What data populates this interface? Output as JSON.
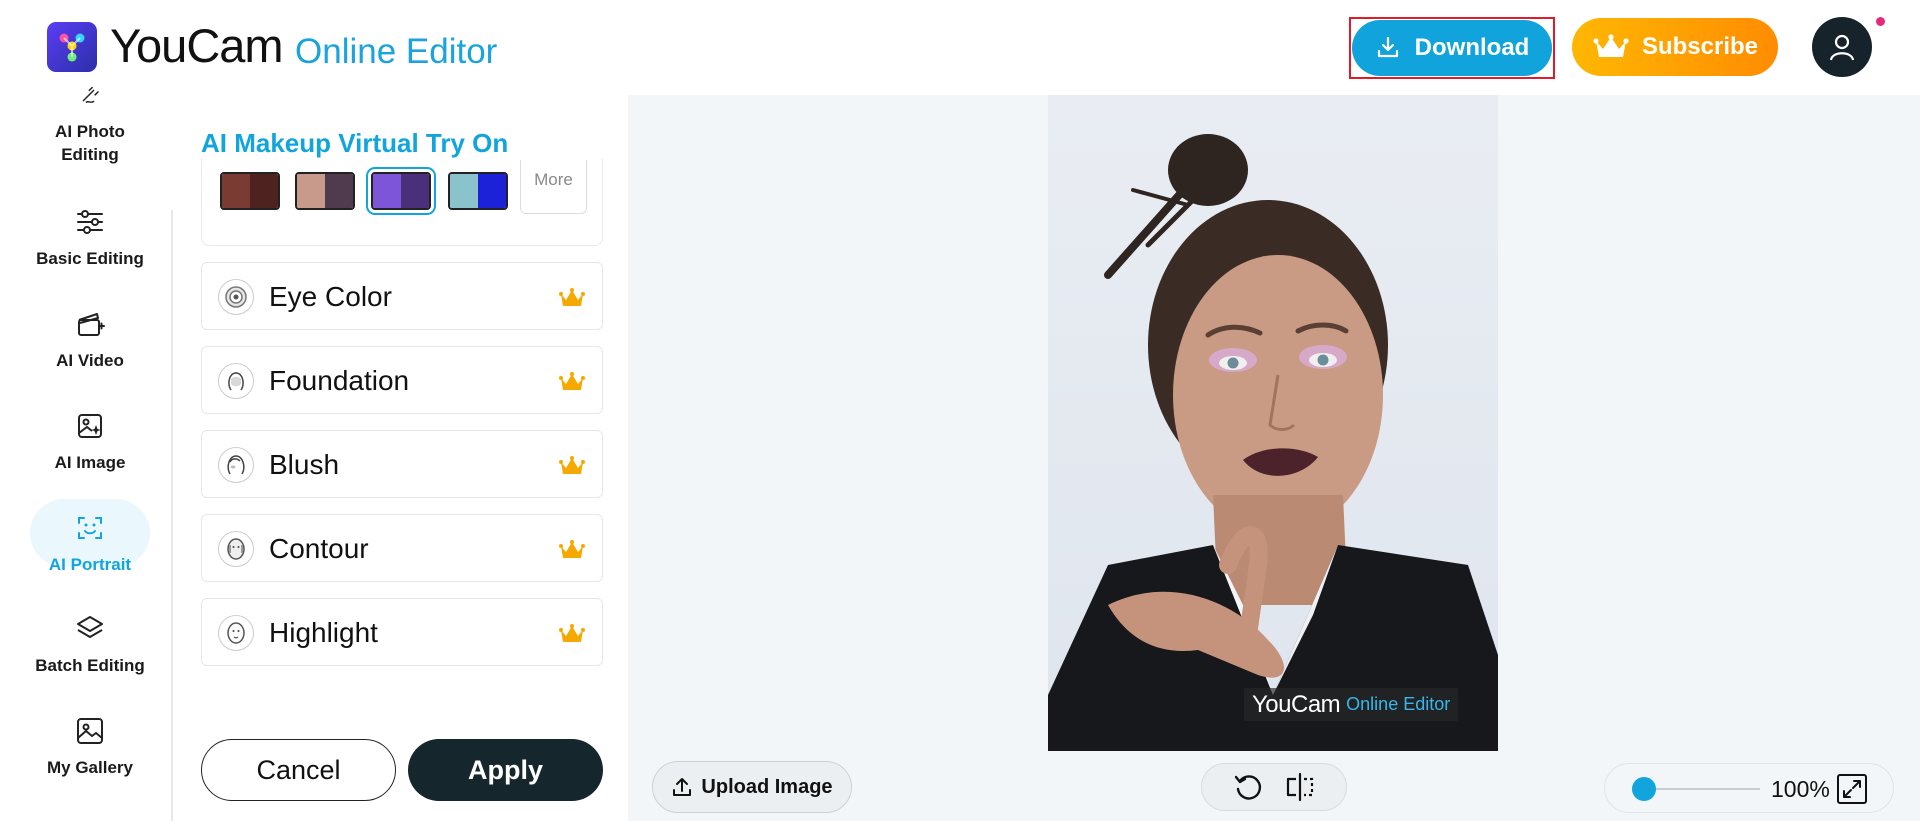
{
  "header": {
    "brand": "YouCam",
    "brand_sub": "Online Editor",
    "download_label": "Download",
    "subscribe_label": "Subscribe"
  },
  "nav": {
    "items": [
      {
        "label": "AI Photo Editing",
        "icon": "magic-wand-icon"
      },
      {
        "label": "Basic Editing",
        "icon": "sliders-icon"
      },
      {
        "label": "AI Video",
        "icon": "clapperboard-icon"
      },
      {
        "label": "AI Image",
        "icon": "image-sparkle-icon"
      },
      {
        "label": "AI Portrait",
        "icon": "face-scan-icon",
        "active": true
      },
      {
        "label": "Batch Editing",
        "icon": "layers-icon"
      },
      {
        "label": "My Gallery",
        "icon": "gallery-icon"
      }
    ]
  },
  "panel": {
    "title": "AI Makeup Virtual Try On",
    "more_label": "More",
    "features": [
      {
        "label": "Eye Color",
        "icon": "eye-color-icon"
      },
      {
        "label": "Foundation",
        "icon": "foundation-icon"
      },
      {
        "label": "Blush",
        "icon": "blush-icon"
      },
      {
        "label": "Contour",
        "icon": "contour-icon"
      },
      {
        "label": "Highlight",
        "icon": "highlight-icon"
      }
    ],
    "cancel_label": "Cancel",
    "apply_label": "Apply"
  },
  "canvas": {
    "watermark_brand": "YouCam",
    "watermark_sub": "Online Editor",
    "upload_label": "Upload Image",
    "zoom_value": "100%",
    "zoom_level": 0.1
  },
  "colors": {
    "accent": "#12a4dd",
    "subscribe_gradient_start": "#ffb703",
    "subscribe_gradient_end": "#ff8c00",
    "crown": "#f5a800",
    "apply_bg": "#16262d"
  }
}
